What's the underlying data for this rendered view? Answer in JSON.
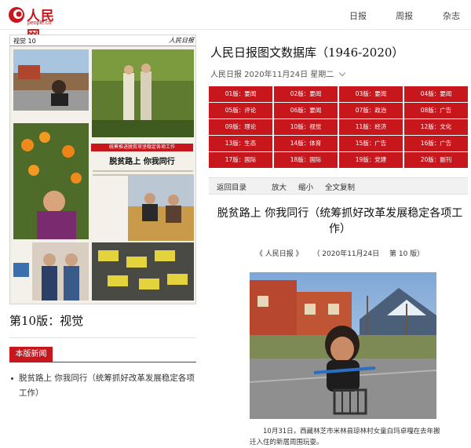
{
  "header": {
    "logo_text": "人民网",
    "logo_domain": "people.cn",
    "nav": [
      "日报",
      "周报",
      "杂志"
    ]
  },
  "left": {
    "paper_header_left": "视觉  10",
    "paper_header_right": "人民日报",
    "paper_subtitle": "统筹推进脱贫攻坚稳定各项工作",
    "paper_title": "脱贫路上  你我同行",
    "section_name": "第10版：视觉",
    "news_tag": "本版新闻",
    "news_items": [
      "脱贫路上 你我同行（统筹抓好改革发展稳定各项工作）"
    ]
  },
  "right": {
    "db_title": "人民日报图文数据库（1946-2020）",
    "date_line": "人民日报  2020年11月24日  星期二",
    "editions": [
      "01版：要闻",
      "02版：要闻",
      "03版：要闻",
      "04版：要闻",
      "05版：评论",
      "06版：要闻",
      "07版：政治",
      "08版：广告",
      "09版：理论",
      "10版：视觉",
      "11版：经济",
      "12版：文化",
      "13版：生态",
      "14版：体育",
      "15版：广告",
      "16版：广告",
      "17版：国际",
      "18版：国际",
      "19版：党建",
      "20版：副刊"
    ],
    "toolbar": {
      "back": "返回目录",
      "zoom_in": "放大",
      "zoom_out": "缩小",
      "copy": "全文复制"
    },
    "article_title": "脱贫路上 你我同行（统筹抓好改革发展稳定各项工作）",
    "meta": {
      "source": "《 人民日报 》",
      "date": "（ 2020年11月24日",
      "page": "第  10 版）"
    },
    "caption": "10月31日，西藏林芝市米林县琼林村女童白玛卓嘎在去年搬迁入住的新居周围玩耍。"
  },
  "colors": {
    "brand_red": "#c8161d",
    "grid_red": "#c8161d"
  }
}
